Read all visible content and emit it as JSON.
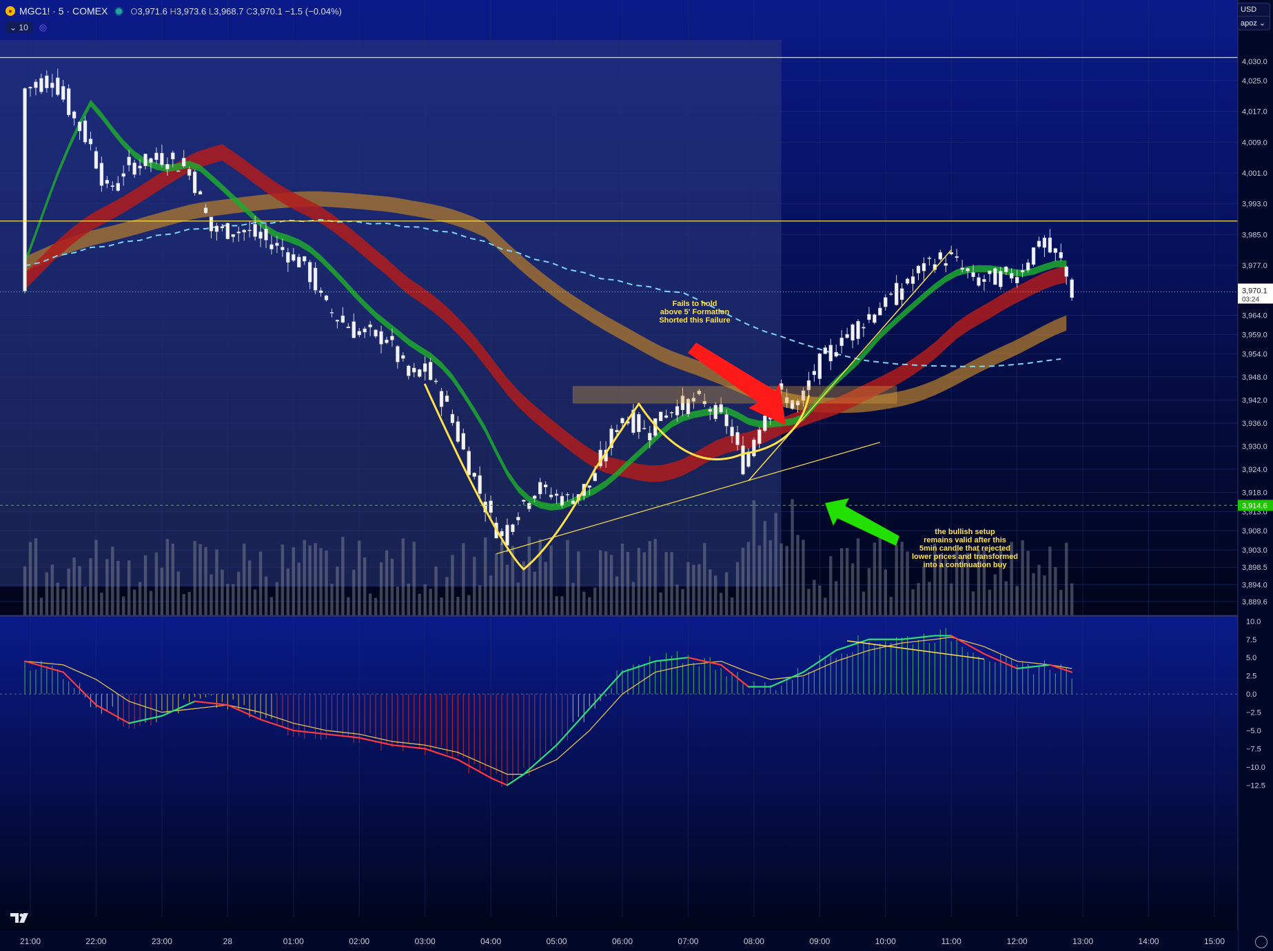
{
  "header": {
    "symbol": "MGC1!",
    "interval": "5",
    "exchange": "COMEX",
    "title": "MGC1! · 5 · COMEX",
    "ohlc": {
      "open_label": "O",
      "open": "3,971.6",
      "high_label": "H",
      "high": "3,973.6",
      "low_label": "L",
      "low": "3,968.7",
      "close_label": "C",
      "close": "3,970.1",
      "change": "−1.5 (−0.04%)"
    },
    "indicator_count": "10"
  },
  "currency_menu": {
    "currency": "USD",
    "profile": "apoz"
  },
  "colors": {
    "background": "#060b33",
    "session_shade": "#2c3a7a",
    "bull": "#e8e8e8",
    "bear": "#e8e8e8",
    "annotation": "#ffe14a",
    "red_arrow": "#ff1a1a",
    "green_arrow": "#22e000",
    "axis_text": "#c8ccd8",
    "price_tag": "#ffffff",
    "level_green": "#21c400"
  },
  "annotations": {
    "short_note": [
      "Fails to hold",
      "above 5' Formation",
      "Shorted this Failure"
    ],
    "long_note": [
      "the bullish setup",
      "remains valid after this",
      "5min candle that rejected",
      "lower prices and transformed",
      "into a continuation buy"
    ]
  },
  "chart_data": [
    {
      "type": "candlestick",
      "title": "MGC1! · 5 · COMEX",
      "ylim": [
        3886,
        4037
      ],
      "y_ticks": [
        "4,030.0",
        "4,025.0",
        "4,017.0",
        "4,009.0",
        "4,001.0",
        "3,993.0",
        "3,985.0",
        "3,977.0",
        "3,964.0",
        "3,959.0",
        "3,954.0",
        "3,948.0",
        "3,942.0",
        "3,936.0",
        "3,930.0",
        "3,924.0",
        "3,918.0",
        "3,913.0",
        "3,908.0",
        "3,903.0",
        "3,898.5",
        "3,894.0",
        "3,889.6"
      ],
      "x_ticks": [
        "21:00",
        "22:00",
        "23:00",
        "28",
        "01:00",
        "02:00",
        "03:00",
        "04:00",
        "05:00",
        "06:00",
        "07:00",
        "08:00",
        "09:00",
        "10:00",
        "11:00",
        "12:00",
        "13:00",
        "14:00",
        "15:00"
      ],
      "last_price": 3970.1,
      "last_price_label": "3,970.1",
      "countdown": "03:24",
      "marked_level": 3914.6,
      "marked_level_label": "3,914.6",
      "horizontal_levels": [
        4031,
        3988.5
      ],
      "close_path": [
        {
          "t": "20:55",
          "p": 4023
        },
        {
          "t": "21:20",
          "p": 4026
        },
        {
          "t": "21:40",
          "p": 4015
        },
        {
          "t": "21:55",
          "p": 4008
        },
        {
          "t": "22:10",
          "p": 3996
        },
        {
          "t": "22:30",
          "p": 4003
        },
        {
          "t": "23:00",
          "p": 4005
        },
        {
          "t": "23:25",
          "p": 4002
        },
        {
          "t": "23:45",
          "p": 3986
        },
        {
          "t": "00:15",
          "p": 3986
        },
        {
          "t": "00:45",
          "p": 3982
        },
        {
          "t": "01:10",
          "p": 3977
        },
        {
          "t": "01:30",
          "p": 3966
        },
        {
          "t": "01:55",
          "p": 3960
        },
        {
          "t": "02:25",
          "p": 3958
        },
        {
          "t": "02:45",
          "p": 3948
        },
        {
          "t": "03:00",
          "p": 3950
        },
        {
          "t": "03:20",
          "p": 3940
        },
        {
          "t": "03:40",
          "p": 3925
        },
        {
          "t": "04:00",
          "p": 3911
        },
        {
          "t": "04:10",
          "p": 3906
        },
        {
          "t": "04:20",
          "p": 3912
        },
        {
          "t": "04:40",
          "p": 3919
        },
        {
          "t": "05:10",
          "p": 3916
        },
        {
          "t": "05:30",
          "p": 3920
        },
        {
          "t": "05:45",
          "p": 3930
        },
        {
          "t": "06:00",
          "p": 3938
        },
        {
          "t": "06:20",
          "p": 3934
        },
        {
          "t": "06:45",
          "p": 3940
        },
        {
          "t": "07:10",
          "p": 3942
        },
        {
          "t": "07:35",
          "p": 3936
        },
        {
          "t": "07:50",
          "p": 3925
        },
        {
          "t": "08:05",
          "p": 3936
        },
        {
          "t": "08:20",
          "p": 3944
        },
        {
          "t": "08:40",
          "p": 3940
        },
        {
          "t": "08:55",
          "p": 3950
        },
        {
          "t": "09:20",
          "p": 3958
        },
        {
          "t": "09:45",
          "p": 3964
        },
        {
          "t": "10:10",
          "p": 3970
        },
        {
          "t": "10:40",
          "p": 3978
        },
        {
          "t": "11:00",
          "p": 3979
        },
        {
          "t": "11:20",
          "p": 3973
        },
        {
          "t": "11:45",
          "p": 3974
        },
        {
          "t": "12:00",
          "p": 3975
        },
        {
          "t": "12:20",
          "p": 3983
        },
        {
          "t": "12:40",
          "p": 3978
        },
        {
          "t": "12:50",
          "p": 3970
        }
      ]
    },
    {
      "type": "line",
      "title": "oscillator",
      "ylim": [
        -13.5,
        10.5
      ],
      "y_ticks": [
        "10.0",
        "7.5",
        "5.0",
        "2.5",
        "0.0",
        "−2.5",
        "−5.0",
        "−7.5",
        "−10.0",
        "−12.5"
      ],
      "x": [
        "20:55",
        "21:30",
        "22:00",
        "22:30",
        "23:00",
        "23:30",
        "00:00",
        "00:30",
        "01:00",
        "01:30",
        "02:00",
        "02:30",
        "03:00",
        "03:30",
        "04:00",
        "04:15",
        "04:30",
        "05:00",
        "05:30",
        "06:00",
        "06:30",
        "07:00",
        "07:30",
        "07:55",
        "08:15",
        "08:45",
        "09:15",
        "09:45",
        "10:15",
        "10:45",
        "11:00",
        "11:30",
        "12:00",
        "12:30",
        "12:50"
      ],
      "series": [
        {
          "values": [
            4.5,
            3,
            -1.5,
            -4,
            -3,
            -1,
            -1.5,
            -3.5,
            -5,
            -5.5,
            -6,
            -7,
            -7.5,
            -9,
            -11.5,
            -12.5,
            -11,
            -7,
            -2,
            3,
            4.5,
            5,
            4,
            1,
            1,
            3,
            6,
            7.5,
            7.5,
            8,
            8,
            5.5,
            3.5,
            4,
            3
          ]
        },
        {
          "values": [
            4.5,
            4,
            2,
            -1,
            -2.5,
            -2,
            -1.5,
            -2.5,
            -4,
            -5,
            -5.5,
            -6.5,
            -7,
            -8,
            -10,
            -11,
            -11,
            -9,
            -5,
            0,
            3,
            4,
            4.5,
            3,
            2,
            2.5,
            4.5,
            6,
            7,
            7.5,
            7.8,
            6.5,
            4.5,
            4,
            3.5
          ]
        }
      ]
    }
  ]
}
